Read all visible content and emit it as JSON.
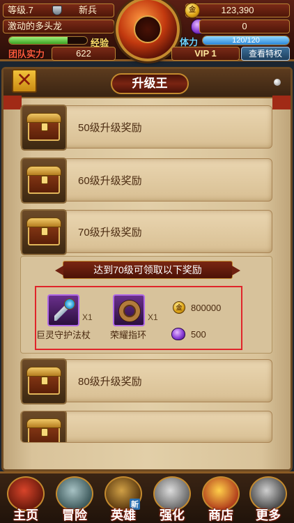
{
  "player": {
    "level_label": "等级.7",
    "rank": "新兵",
    "name": "激动的多头龙",
    "exp_label": "经验",
    "exp_fraction": 0.75,
    "team_power_label": "团队实力",
    "team_power": "622",
    "gold": "123,390",
    "gold_icon_text": "金",
    "gems": "0",
    "stamina_label": "体力",
    "stamina": "120/120",
    "stamina_fraction": 1.0,
    "vip": "VIP 1",
    "privilege_button": "查看特权"
  },
  "panel": {
    "title": "升级王",
    "close_symbol": "✕"
  },
  "rewards": [
    {
      "label": "50级升级奖励"
    },
    {
      "label": "60级升级奖励"
    },
    {
      "label": "70级升级奖励"
    }
  ],
  "detail": {
    "header": "达到70级可领取以下奖励",
    "items": [
      {
        "name": "巨灵守护法杖",
        "qty": "X1"
      },
      {
        "name": "荣耀指环",
        "qty": "X1"
      }
    ],
    "resources": [
      {
        "type": "gold",
        "icon_text": "金",
        "value": "800000"
      },
      {
        "type": "gem",
        "value": "500"
      }
    ]
  },
  "rewards_after": [
    {
      "label": "80级升级奖励"
    }
  ],
  "nav": [
    {
      "label": "主页",
      "icon": "home-icon"
    },
    {
      "label": "冒险",
      "icon": "adventure-icon"
    },
    {
      "label": "英雄",
      "icon": "hero-icon",
      "badge": "新"
    },
    {
      "label": "强化",
      "icon": "forge-icon"
    },
    {
      "label": "商店",
      "icon": "shop-icon"
    },
    {
      "label": "更多",
      "icon": "more-icon"
    }
  ],
  "colors": {
    "accent_gold": "#c48a2e",
    "title_red": "#7a2412",
    "highlight_red": "#e0242a",
    "item_purple": "#b06ae6"
  }
}
